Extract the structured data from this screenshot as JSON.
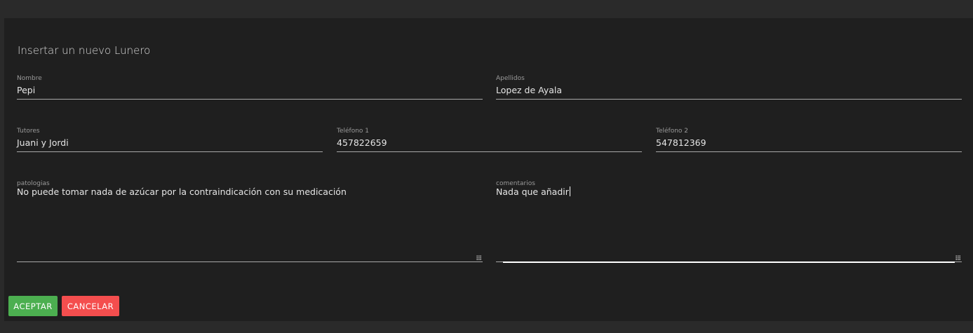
{
  "form": {
    "title": "Insertar un nuevo Lunero",
    "nombre": {
      "label": "Nombre",
      "value": "Pepi"
    },
    "apellidos": {
      "label": "Apellidos",
      "value": "Lopez de Ayala"
    },
    "tutores": {
      "label": "Tutores",
      "value": "Juani y Jordi"
    },
    "telefono1": {
      "label": "Teléfono 1",
      "value": "457822659"
    },
    "telefono2": {
      "label": "Teléfono 2",
      "value": "547812369"
    },
    "patologias": {
      "label": "patologias",
      "value": "No puede tomar nada de azúcar por la contraindicación con su medicación"
    },
    "comentarios": {
      "label": "comentarios",
      "value": "Nada que añadir"
    }
  },
  "actions": {
    "accept_label": "ACEPTAR",
    "cancel_label": "CANCELAR"
  },
  "colors": {
    "accept": "#4caf50",
    "cancel": "#f44e4e",
    "background": "#1f1f1f"
  }
}
